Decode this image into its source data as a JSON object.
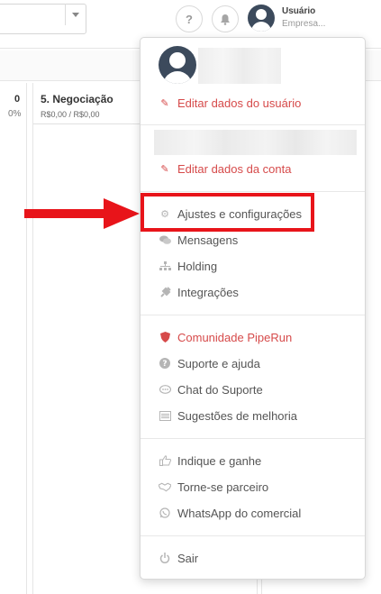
{
  "topbar": {
    "help_icon_glyph": "?",
    "bell_icon": "bell-icon",
    "user_name": "Usuário",
    "user_company": "Empresa..."
  },
  "board": {
    "prev_column_count": "0",
    "prev_column_percent": "0%",
    "column_title": "5. Negociação",
    "column_amount": "R$0,00 / R$0,00"
  },
  "menu": {
    "edit_user": "Editar dados do usuário",
    "edit_account": "Editar dados da conta",
    "settings": "Ajustes e configurações",
    "messages": "Mensagens",
    "holding": "Holding",
    "integrations": "Integrações",
    "community": "Comunidade PipeRun",
    "support": "Suporte e ajuda",
    "support_chat": "Chat do Suporte",
    "suggestions": "Sugestões de melhoria",
    "refer": "Indique e ganhe",
    "partner": "Torne-se parceiro",
    "whatsapp": "WhatsApp do comercial",
    "logout": "Sair"
  },
  "colors": {
    "accent_red": "#d64a4a",
    "highlight_red": "#e8141a",
    "avatar_dark": "#3c4a5c"
  }
}
